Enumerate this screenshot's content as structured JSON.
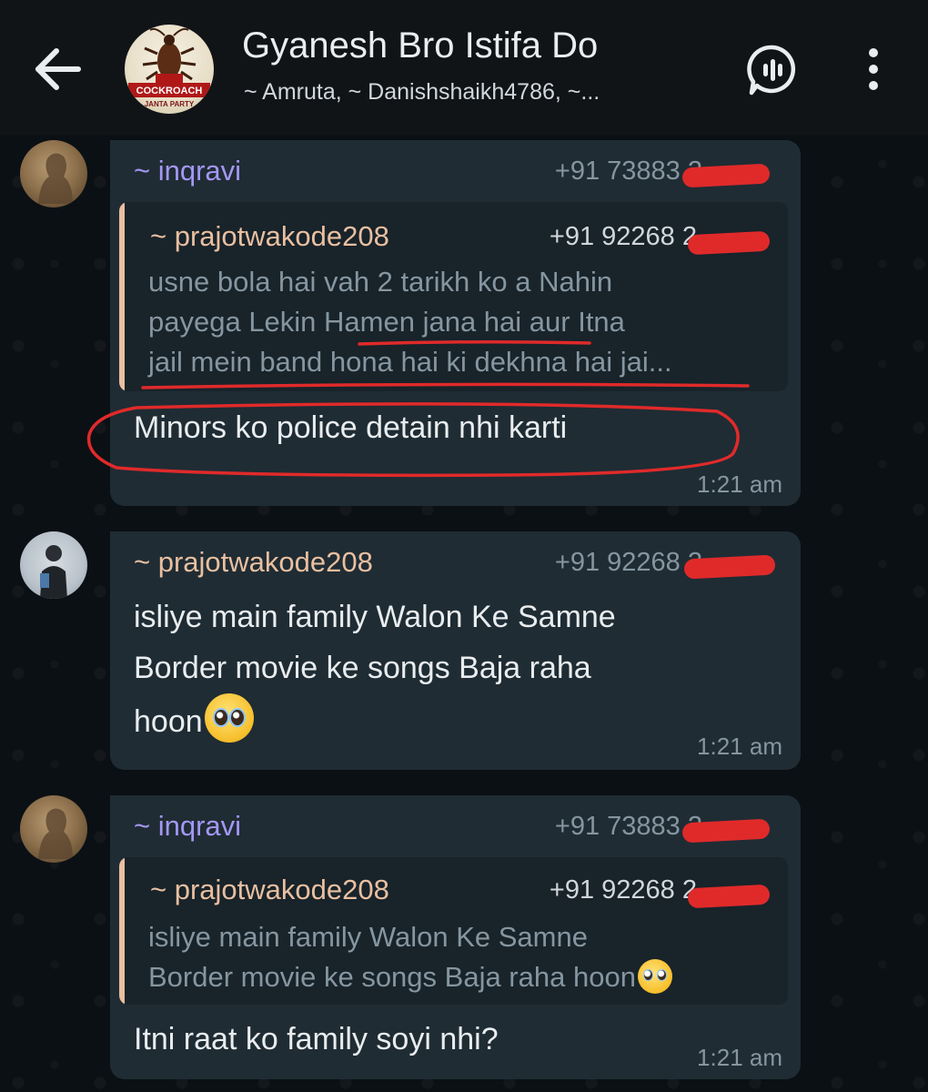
{
  "header": {
    "title": "Gyanesh Bro Istifa Do",
    "members": "~ Amruta, ~ Danishshaikh4786, ~...",
    "avatar_text_1": "COCKROACH",
    "avatar_text_2": "JANTA PARTY"
  },
  "messages": [
    {
      "sender": "~ inqravi",
      "phone": "+91 73883 2",
      "quote": {
        "sender": "~ prajotwakode208",
        "phone": "+91 92268 2",
        "lines": [
          "usne bola hai vah 2 tarikh ko a Nahin",
          "payega Lekin Hamen jana hai aur Itna",
          "jail mein band hona hai ki dekhna hai jai..."
        ]
      },
      "text": "Minors ko police detain nhi karti",
      "time": "1:21 am"
    },
    {
      "sender": "~ prajotwakode208",
      "phone": "+91 92268 2",
      "lines": [
        "isliye main family Walon Ke Samne",
        "Border movie ke songs Baja raha",
        "hoon"
      ],
      "time": "1:21 am"
    },
    {
      "sender": "~ inqravi",
      "phone": "+91 73883 2",
      "quote": {
        "sender": "~ prajotwakode208",
        "phone": "+91 92268 2",
        "lines": [
          "isliye main family Walon Ke Samne",
          "Border movie ke songs Baja raha hoon"
        ]
      },
      "text": "Itni raat ko family soyi nhi?",
      "time": "1:21 am"
    }
  ],
  "colors": {
    "header_bg": "#111417",
    "bubble_bg": "#1f2c34",
    "sender_purple": "#a597f5",
    "sender_peach": "#e9bfa0",
    "annotation_red": "#e02a2a"
  }
}
